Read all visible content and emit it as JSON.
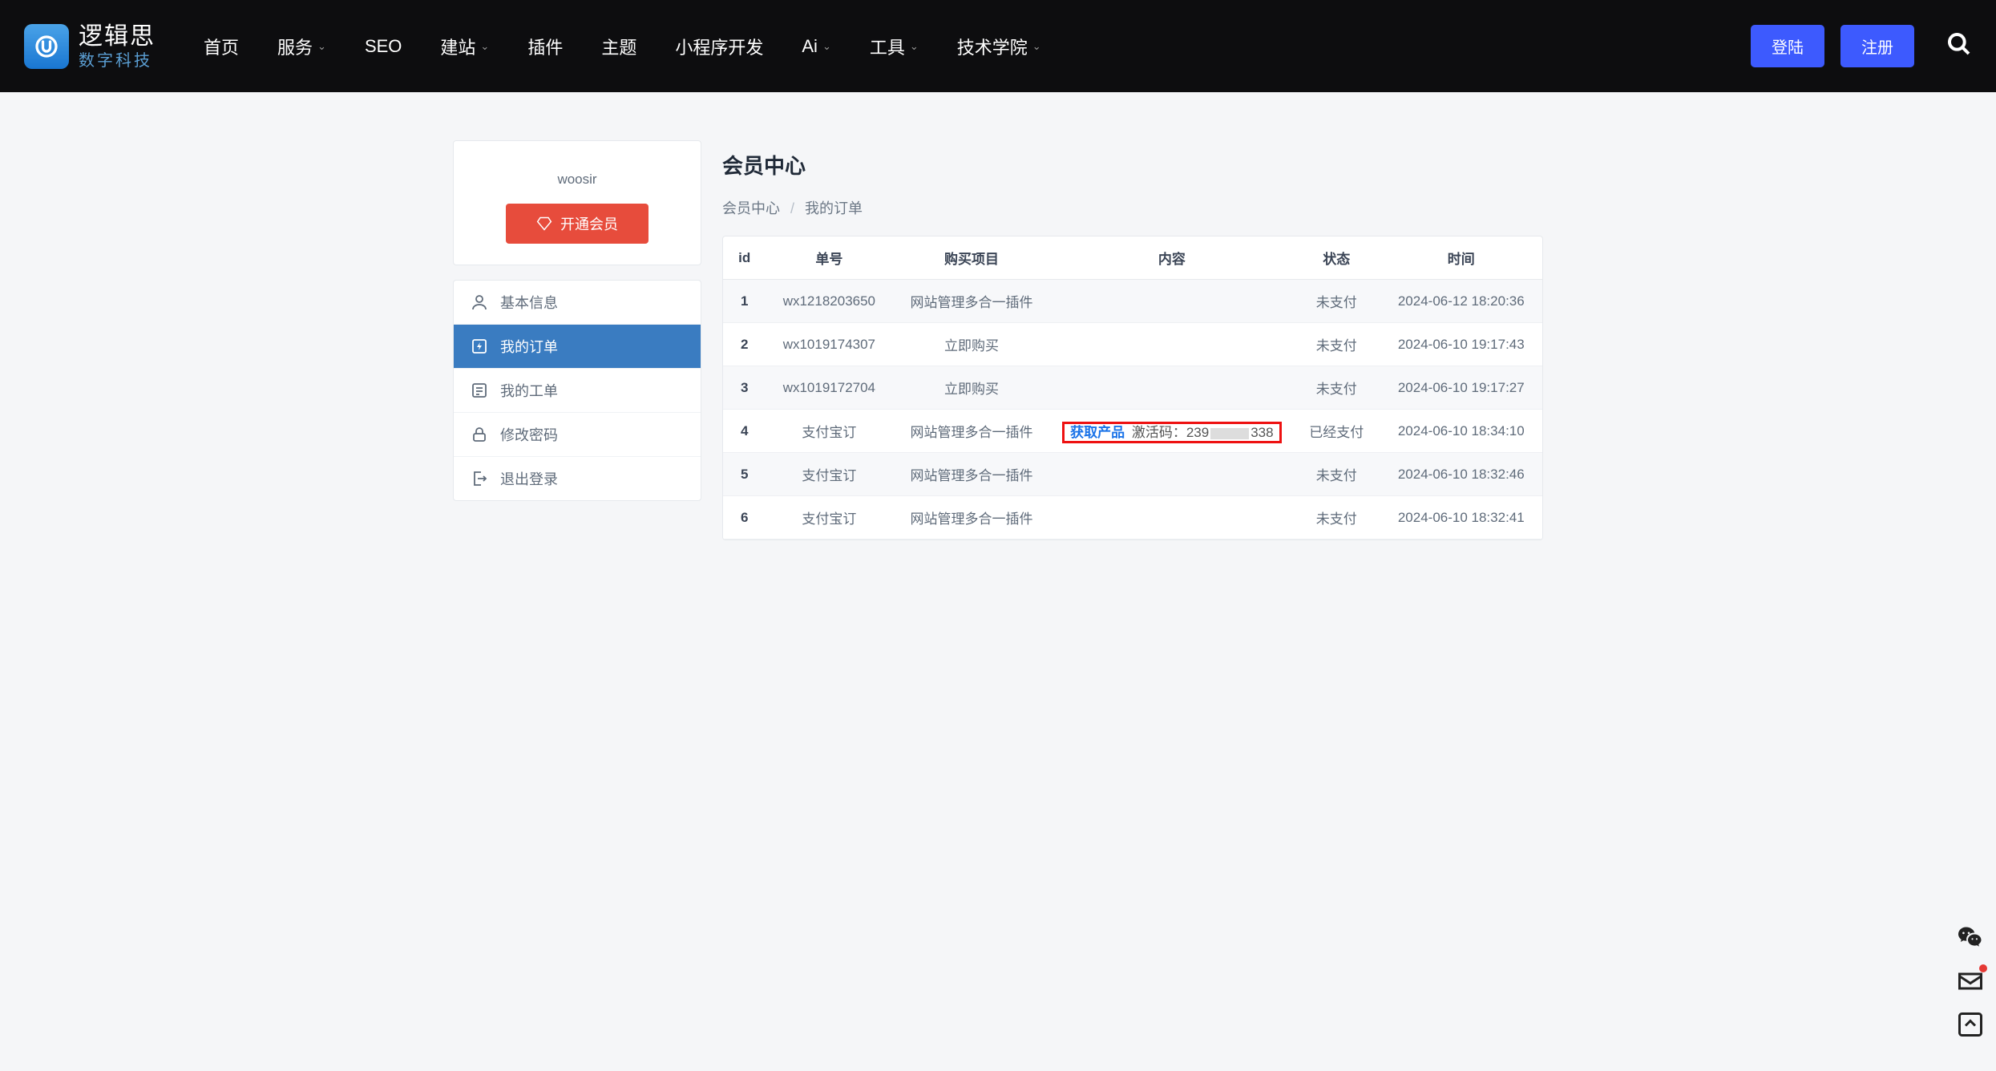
{
  "header": {
    "logo_main": "逻辑思",
    "logo_sub": "数字科技",
    "nav": [
      {
        "label": "首页",
        "dropdown": false
      },
      {
        "label": "服务",
        "dropdown": true
      },
      {
        "label": "SEO",
        "dropdown": false
      },
      {
        "label": "建站",
        "dropdown": true
      },
      {
        "label": "插件",
        "dropdown": false
      },
      {
        "label": "主题",
        "dropdown": false
      },
      {
        "label": "小程序开发",
        "dropdown": false
      },
      {
        "label": "Ai",
        "dropdown": true
      },
      {
        "label": "工具",
        "dropdown": true
      },
      {
        "label": "技术学院",
        "dropdown": true
      }
    ],
    "login_label": "登陆",
    "register_label": "注册"
  },
  "user": {
    "name": "woosir",
    "vip_button": "开通会员"
  },
  "menu": [
    {
      "label": "基本信息",
      "icon": "user-icon",
      "active": false
    },
    {
      "label": "我的订单",
      "icon": "bolt-icon",
      "active": true
    },
    {
      "label": "我的工单",
      "icon": "ticket-icon",
      "active": false
    },
    {
      "label": "修改密码",
      "icon": "lock-icon",
      "active": false
    },
    {
      "label": "退出登录",
      "icon": "logout-icon",
      "active": false
    }
  ],
  "page": {
    "title": "会员中心",
    "breadcrumb_root": "会员中心",
    "breadcrumb_current": "我的订单"
  },
  "table": {
    "headers": [
      "id",
      "单号",
      "购买项目",
      "内容",
      "状态",
      "时间"
    ],
    "rows": [
      {
        "id": "1",
        "order_no": "wx1218203650",
        "project": "网站管理多合一插件",
        "content_type": "none",
        "status": "未支付",
        "time": "2024-06-12 18:20:36"
      },
      {
        "id": "2",
        "order_no": "wx1019174307",
        "project": "立即购买",
        "content_type": "none",
        "status": "未支付",
        "time": "2024-06-10 19:17:43"
      },
      {
        "id": "3",
        "order_no": "wx1019172704",
        "project": "立即购买",
        "content_type": "none",
        "status": "未支付",
        "time": "2024-06-10 19:17:27"
      },
      {
        "id": "4",
        "order_no": "支付宝订",
        "project": "网站管理多合一插件",
        "content_type": "activation",
        "content_label": "获取产品",
        "content_code_prefix": "激活码：239",
        "content_code_suffix": "338",
        "highlight": true,
        "status": "已经支付",
        "time": "2024-06-10 18:34:10"
      },
      {
        "id": "5",
        "order_no": "支付宝订",
        "project": "网站管理多合一插件",
        "content_type": "none",
        "status": "未支付",
        "time": "2024-06-10 18:32:46"
      },
      {
        "id": "6",
        "order_no": "支付宝订",
        "project": "网站管理多合一插件",
        "content_type": "none",
        "status": "未支付",
        "time": "2024-06-10 18:32:41"
      }
    ]
  }
}
